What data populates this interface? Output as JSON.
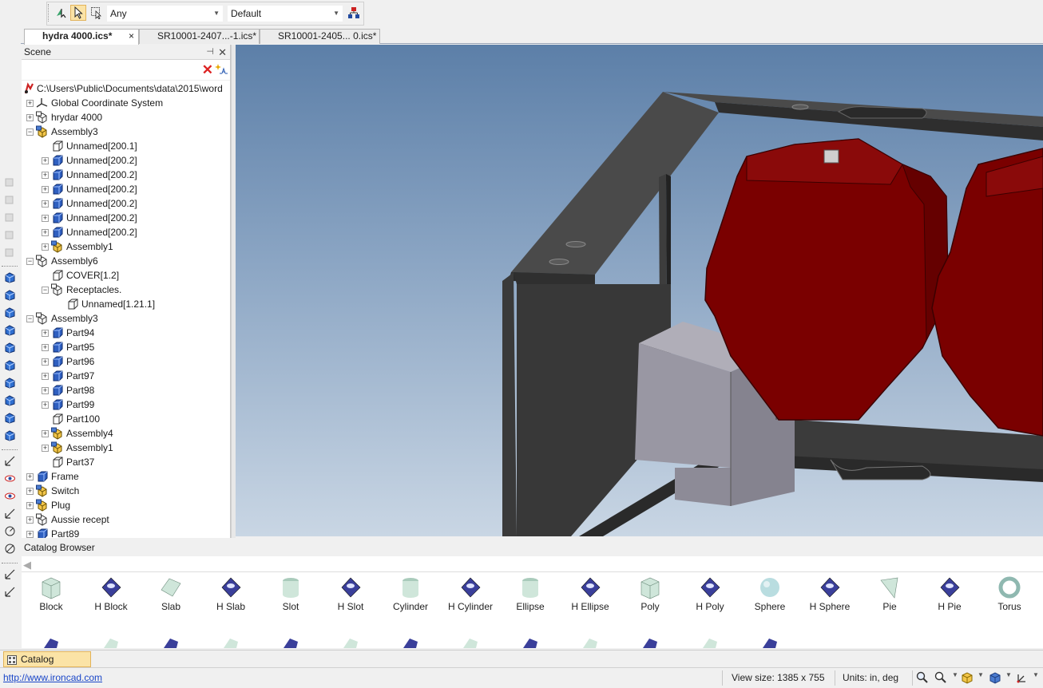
{
  "toolbar": {
    "filter_value": "Any",
    "config_value": "Default",
    "icons": [
      "select-parts-icon",
      "select-pointer-icon",
      "select-box-icon",
      "hierarchy-icon"
    ]
  },
  "tabs": [
    {
      "label": "hydra 4000.ics*",
      "active": true,
      "close": "×"
    },
    {
      "label": "SR10001-2407...-1.ics*",
      "active": false
    },
    {
      "label": "SR10001-2405... 0.ics*",
      "active": false
    }
  ],
  "scene": {
    "title": "Scene",
    "pin": "⊣",
    "close": "✕",
    "delete": "✕",
    "tree": [
      {
        "label": "C:\\Users\\Public\\Documents\\data\\2015\\word",
        "level": 0,
        "icon": "root",
        "exp": ""
      },
      {
        "label": "Global Coordinate System",
        "level": 1,
        "icon": "axis",
        "exp": "+"
      },
      {
        "label": "hrydar 4000",
        "level": 1,
        "icon": "assembly-outline",
        "exp": "+"
      },
      {
        "label": "Assembly3",
        "level": 1,
        "icon": "assembly-yellow",
        "exp": "−"
      },
      {
        "label": "Unnamed[200.1]",
        "level": 2,
        "icon": "part-outline",
        "exp": ""
      },
      {
        "label": "Unnamed[200.2]",
        "level": 2,
        "icon": "part-blue",
        "exp": "+"
      },
      {
        "label": "Unnamed[200.2]",
        "level": 2,
        "icon": "part-blue",
        "exp": "+"
      },
      {
        "label": "Unnamed[200.2]",
        "level": 2,
        "icon": "part-blue",
        "exp": "+"
      },
      {
        "label": "Unnamed[200.2]",
        "level": 2,
        "icon": "part-blue",
        "exp": "+"
      },
      {
        "label": "Unnamed[200.2]",
        "level": 2,
        "icon": "part-blue",
        "exp": "+"
      },
      {
        "label": "Unnamed[200.2]",
        "level": 2,
        "icon": "part-blue",
        "exp": "+"
      },
      {
        "label": "Assembly1",
        "level": 2,
        "icon": "assembly-yellow",
        "exp": "+"
      },
      {
        "label": "Assembly6",
        "level": 1,
        "icon": "assembly-outline",
        "exp": "−"
      },
      {
        "label": "COVER[1.2]",
        "level": 2,
        "icon": "part-outline",
        "exp": ""
      },
      {
        "label": "Receptacles.",
        "level": 2,
        "icon": "assembly-outline",
        "exp": "−"
      },
      {
        "label": "Unnamed[1.21.1]",
        "level": 3,
        "icon": "part-outline",
        "exp": ""
      },
      {
        "label": "Assembly3",
        "level": 1,
        "icon": "assembly-outline",
        "exp": "−"
      },
      {
        "label": "Part94",
        "level": 2,
        "icon": "part-blue",
        "exp": "+"
      },
      {
        "label": "Part95",
        "level": 2,
        "icon": "part-blue",
        "exp": "+"
      },
      {
        "label": "Part96",
        "level": 2,
        "icon": "part-blue",
        "exp": "+"
      },
      {
        "label": "Part97",
        "level": 2,
        "icon": "part-blue",
        "exp": "+"
      },
      {
        "label": "Part98",
        "level": 2,
        "icon": "part-blue",
        "exp": "+"
      },
      {
        "label": "Part99",
        "level": 2,
        "icon": "part-blue",
        "exp": "+"
      },
      {
        "label": "Part100",
        "level": 2,
        "icon": "part-outline",
        "exp": ""
      },
      {
        "label": "Assembly4",
        "level": 2,
        "icon": "assembly-yellow",
        "exp": "+"
      },
      {
        "label": "Assembly1",
        "level": 2,
        "icon": "assembly-yellow",
        "exp": "+"
      },
      {
        "label": "Part37",
        "level": 2,
        "icon": "part-outline",
        "exp": ""
      },
      {
        "label": "Frame",
        "level": 1,
        "icon": "part-blue",
        "exp": "+"
      },
      {
        "label": "Switch",
        "level": 1,
        "icon": "assembly-yellow",
        "exp": "+"
      },
      {
        "label": "Plug",
        "level": 1,
        "icon": "assembly-yellow",
        "exp": "+"
      },
      {
        "label": "Aussie recept",
        "level": 1,
        "icon": "assembly-outline",
        "exp": "+"
      },
      {
        "label": "Part89",
        "level": 1,
        "icon": "part-blue",
        "exp": "+"
      }
    ]
  },
  "catalog": {
    "title": "Catalog Browser",
    "back": "◀",
    "items": [
      {
        "label": "Block",
        "shape": "block"
      },
      {
        "label": "H Block",
        "shape": "h-block"
      },
      {
        "label": "Slab",
        "shape": "slab"
      },
      {
        "label": "H Slab",
        "shape": "h-slab"
      },
      {
        "label": "Slot",
        "shape": "slot"
      },
      {
        "label": "H Slot",
        "shape": "h-slot"
      },
      {
        "label": "Cylinder",
        "shape": "cylinder"
      },
      {
        "label": "H Cylinder",
        "shape": "h-cylinder"
      },
      {
        "label": "Ellipse",
        "shape": "ellipse"
      },
      {
        "label": "H Ellipse",
        "shape": "h-ellipse"
      },
      {
        "label": "Poly",
        "shape": "poly"
      },
      {
        "label": "H Poly",
        "shape": "h-poly"
      },
      {
        "label": "Sphere",
        "shape": "sphere"
      },
      {
        "label": "H Sphere",
        "shape": "h-sphere"
      },
      {
        "label": "Pie",
        "shape": "pie"
      },
      {
        "label": "H Pie",
        "shape": "h-pie"
      },
      {
        "label": "Torus",
        "shape": "torus"
      }
    ]
  },
  "bottom_tab": {
    "label": "Catalog Browser"
  },
  "status": {
    "link": "http://www.ironcad.com",
    "view_size": "View size: 1385 x  755",
    "units": "Units: in, deg"
  },
  "colors": {
    "accent_yellow": "#fbe3a6",
    "part_red": "#7a0000",
    "frame_dark": "#3a3a3a",
    "viewport_top": "#5c7fa8",
    "viewport_bottom": "#c9d6e4"
  }
}
